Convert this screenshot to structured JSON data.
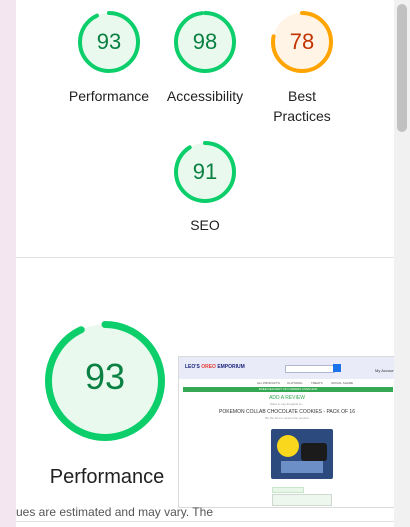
{
  "categories": [
    {
      "id": "performance",
      "score": "93",
      "value": 93,
      "label": "Performance",
      "color": "#0cce6b",
      "text_color": "#0b8043",
      "fill": "#e9f9ee"
    },
    {
      "id": "accessibility",
      "score": "98",
      "value": 98,
      "label": "Accessibility",
      "color": "#0cce6b",
      "text_color": "#0b8043",
      "fill": "#e9f9ee"
    },
    {
      "id": "best_practices",
      "score": "78",
      "value": 78,
      "label": "Best Practices",
      "color": "#ffa400",
      "text_color": "#c33300",
      "fill": "#fff4e5"
    },
    {
      "id": "seo",
      "score": "91",
      "value": 91,
      "label": "SEO",
      "color": "#0cce6b",
      "text_color": "#0b8043",
      "fill": "#e9f9ee"
    }
  ],
  "performance_section": {
    "score": "93",
    "value": 93,
    "label": "Performance",
    "color": "#0cce6b",
    "footnote": "ues are estimated and may vary. The"
  },
  "screenshot": {
    "brand_prefix": "LEO'S",
    "brand_oreo": "OREO",
    "brand_suffix": "EMPORIUM",
    "account": "My Account",
    "nav": [
      "ALL PRODUCTS",
      "CLOTHING",
      "TREATS",
      "SOCIAL SHARE"
    ],
    "banner": "FREE DELIVERY ON ORDERS OVER £10!",
    "review_heading": "ADD A REVIEW",
    "review_sub": "Want to say thoughts to...",
    "product_title": "POKEMON COLLAB CHOCOLATE COOKIES - PACK OF 16",
    "review_note": "Be the first to review this product"
  },
  "icons": {
    "scroll_thumb": "scrollbar-thumb"
  }
}
